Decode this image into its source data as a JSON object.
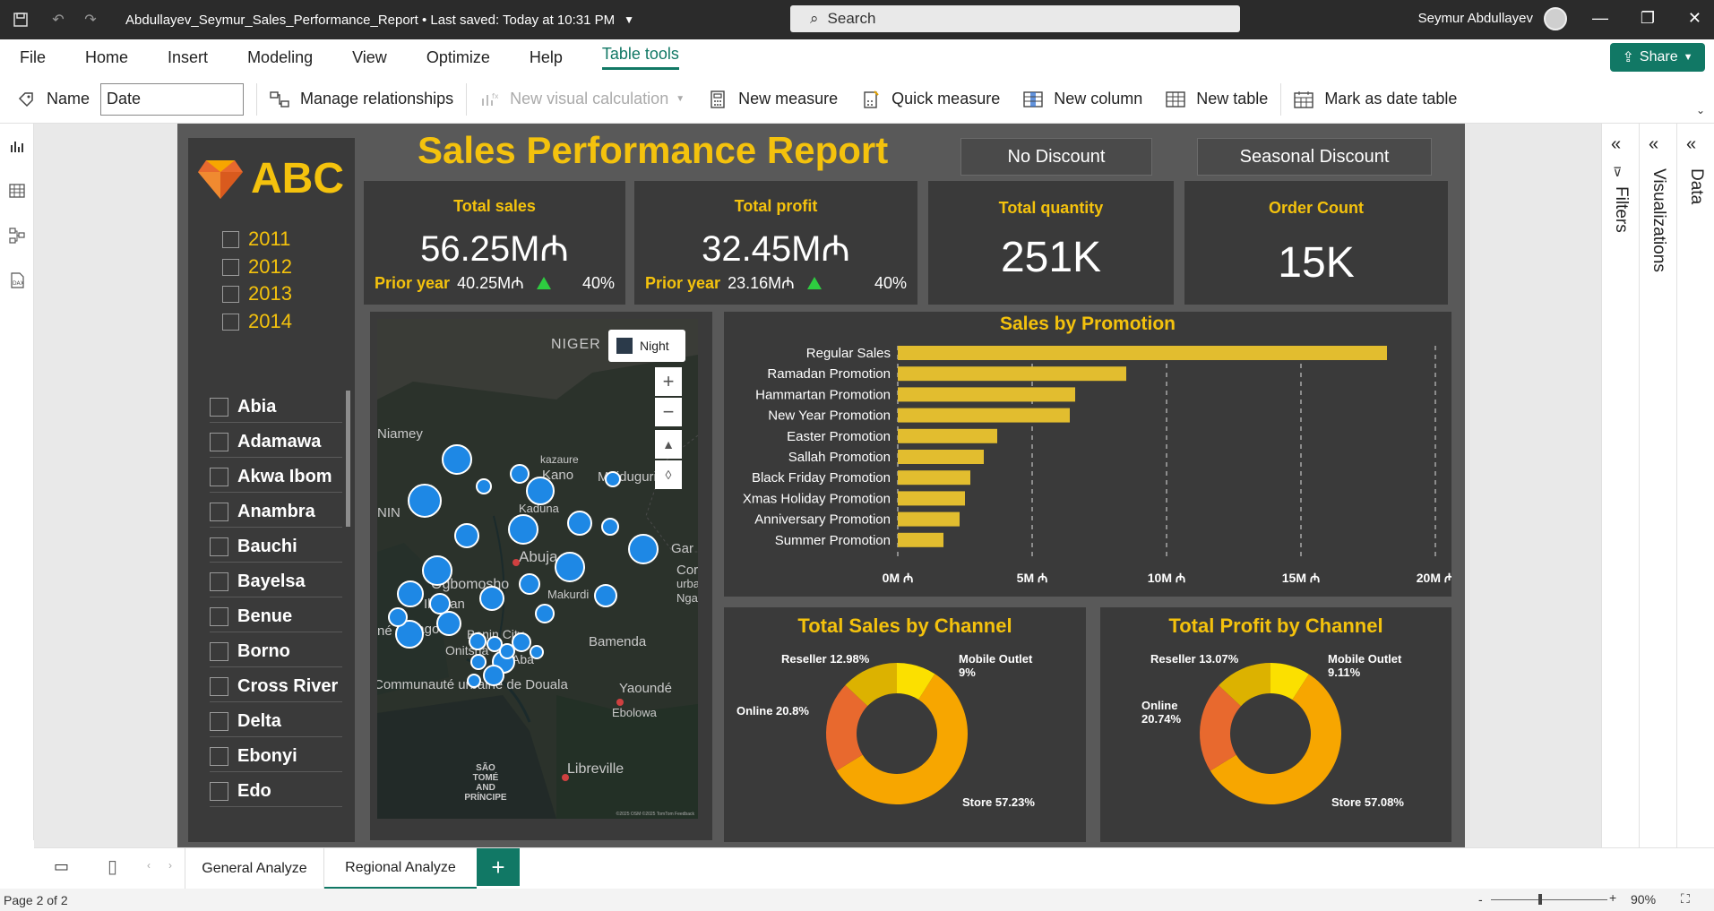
{
  "window": {
    "title": "Abdullayev_Seymur_Sales_Performance_Report • Last saved: Today at 10:31 PM",
    "search_placeholder": "Search",
    "user": "Seymur Abdullayev"
  },
  "menu": [
    "File",
    "Home",
    "Insert",
    "Modeling",
    "View",
    "Optimize",
    "Help",
    "Table tools"
  ],
  "share_label": "Share",
  "ribbon": {
    "name_label": "Name",
    "name_value": "Date",
    "manage_relationships": "Manage relationships",
    "new_visual_calc": "New visual calculation",
    "new_measure": "New measure",
    "quick_measure": "Quick measure",
    "new_column": "New column",
    "new_table": "New table",
    "mark_date_table": "Mark as date table"
  },
  "report": {
    "logo_text": "ABC",
    "title": "Sales Performance Report",
    "discount_buttons": [
      "No Discount",
      "Seasonal Discount"
    ],
    "years": [
      "2011",
      "2012",
      "2013",
      "2014"
    ],
    "regions": [
      "Abia",
      "Adamawa",
      "Akwa Ibom",
      "Anambra",
      "Bauchi",
      "Bayelsa",
      "Benue",
      "Borno",
      "Cross River",
      "Delta",
      "Ebonyi",
      "Edo"
    ],
    "kpis": {
      "total_sales": {
        "title": "Total sales",
        "value": "56.25M₼",
        "prior_label": "Prior year",
        "prior_value": "40.25M₼",
        "pct": "40%"
      },
      "total_profit": {
        "title": "Total profit",
        "value": "32.45M₼",
        "prior_label": "Prior year",
        "prior_value": "23.16M₼",
        "pct": "40%"
      },
      "total_quantity": {
        "title": "Total quantity",
        "value": "251K"
      },
      "order_count": {
        "title": "Order Count",
        "value": "15K"
      }
    },
    "map": {
      "style_label": "Night",
      "labels": [
        "NIGER",
        "Niamey",
        "kazaure",
        "Kano",
        "Maiduguri",
        "NIN",
        "Kaduna",
        "Abuja",
        "Gar",
        "Cor",
        "urba",
        "Nga",
        "Ogbomosho",
        "Ibadan",
        "Makurdi",
        "Lagos",
        "Benin City",
        "Onitsha",
        "Aba",
        "Bamenda",
        "Communauté urbaine de Douala",
        "Yaoundé",
        "Ebolowa",
        "SÃO TOMÉ AND PRÍNCIPE",
        "Libreville",
        "né"
      ],
      "credit": "©2025 OSM ©2025 TomTom Feedback"
    },
    "accent_color": "#f4c20d",
    "bubble_color": "#1e88e5"
  },
  "chart_data": [
    {
      "type": "bar",
      "title": "Sales by Promotion",
      "categories": [
        "Regular Sales",
        "Ramadan Promotion",
        "Hammartan Promotion",
        "New Year Promotion",
        "Easter Promotion",
        "Sallah Promotion",
        "Black Friday Promotion",
        "Xmas Holiday Promotion",
        "Anniversary Promotion",
        "Summer Promotion"
      ],
      "values": [
        18.2,
        8.5,
        6.6,
        6.4,
        3.7,
        3.2,
        2.7,
        2.5,
        2.3,
        1.7
      ],
      "xticks": [
        "0M ₼",
        "5M ₼",
        "10M ₼",
        "15M ₼",
        "20M ₼"
      ],
      "xlim": [
        0,
        20
      ],
      "color": "#e2bd2f"
    },
    {
      "type": "pie",
      "title": "Total Sales by Channel",
      "labels": [
        "Store 57.23%",
        "Online 20.8%",
        "Reseller 12.98%",
        "Mobile Outlet 9%"
      ],
      "values": [
        57.23,
        20.8,
        12.98,
        9
      ],
      "colors": [
        "#f7a600",
        "#e8692e",
        "#dcb200",
        "#fbe000"
      ]
    },
    {
      "type": "pie",
      "title": "Total Profit by Channel",
      "labels": [
        "Store 57.08%",
        "Online 20.74%",
        "Reseller 13.07%",
        "Mobile Outlet 9.11%"
      ],
      "values": [
        57.08,
        20.74,
        13.07,
        9.11
      ],
      "colors": [
        "#f7a600",
        "#e8692e",
        "#dcb200",
        "#fbe000"
      ]
    }
  ],
  "right_panes": [
    "Filters",
    "Visualizations",
    "Data"
  ],
  "tabs": [
    "General Analyze",
    "Regional Analyze"
  ],
  "status": {
    "page": "Page 2 of 2",
    "zoom": "90%"
  }
}
